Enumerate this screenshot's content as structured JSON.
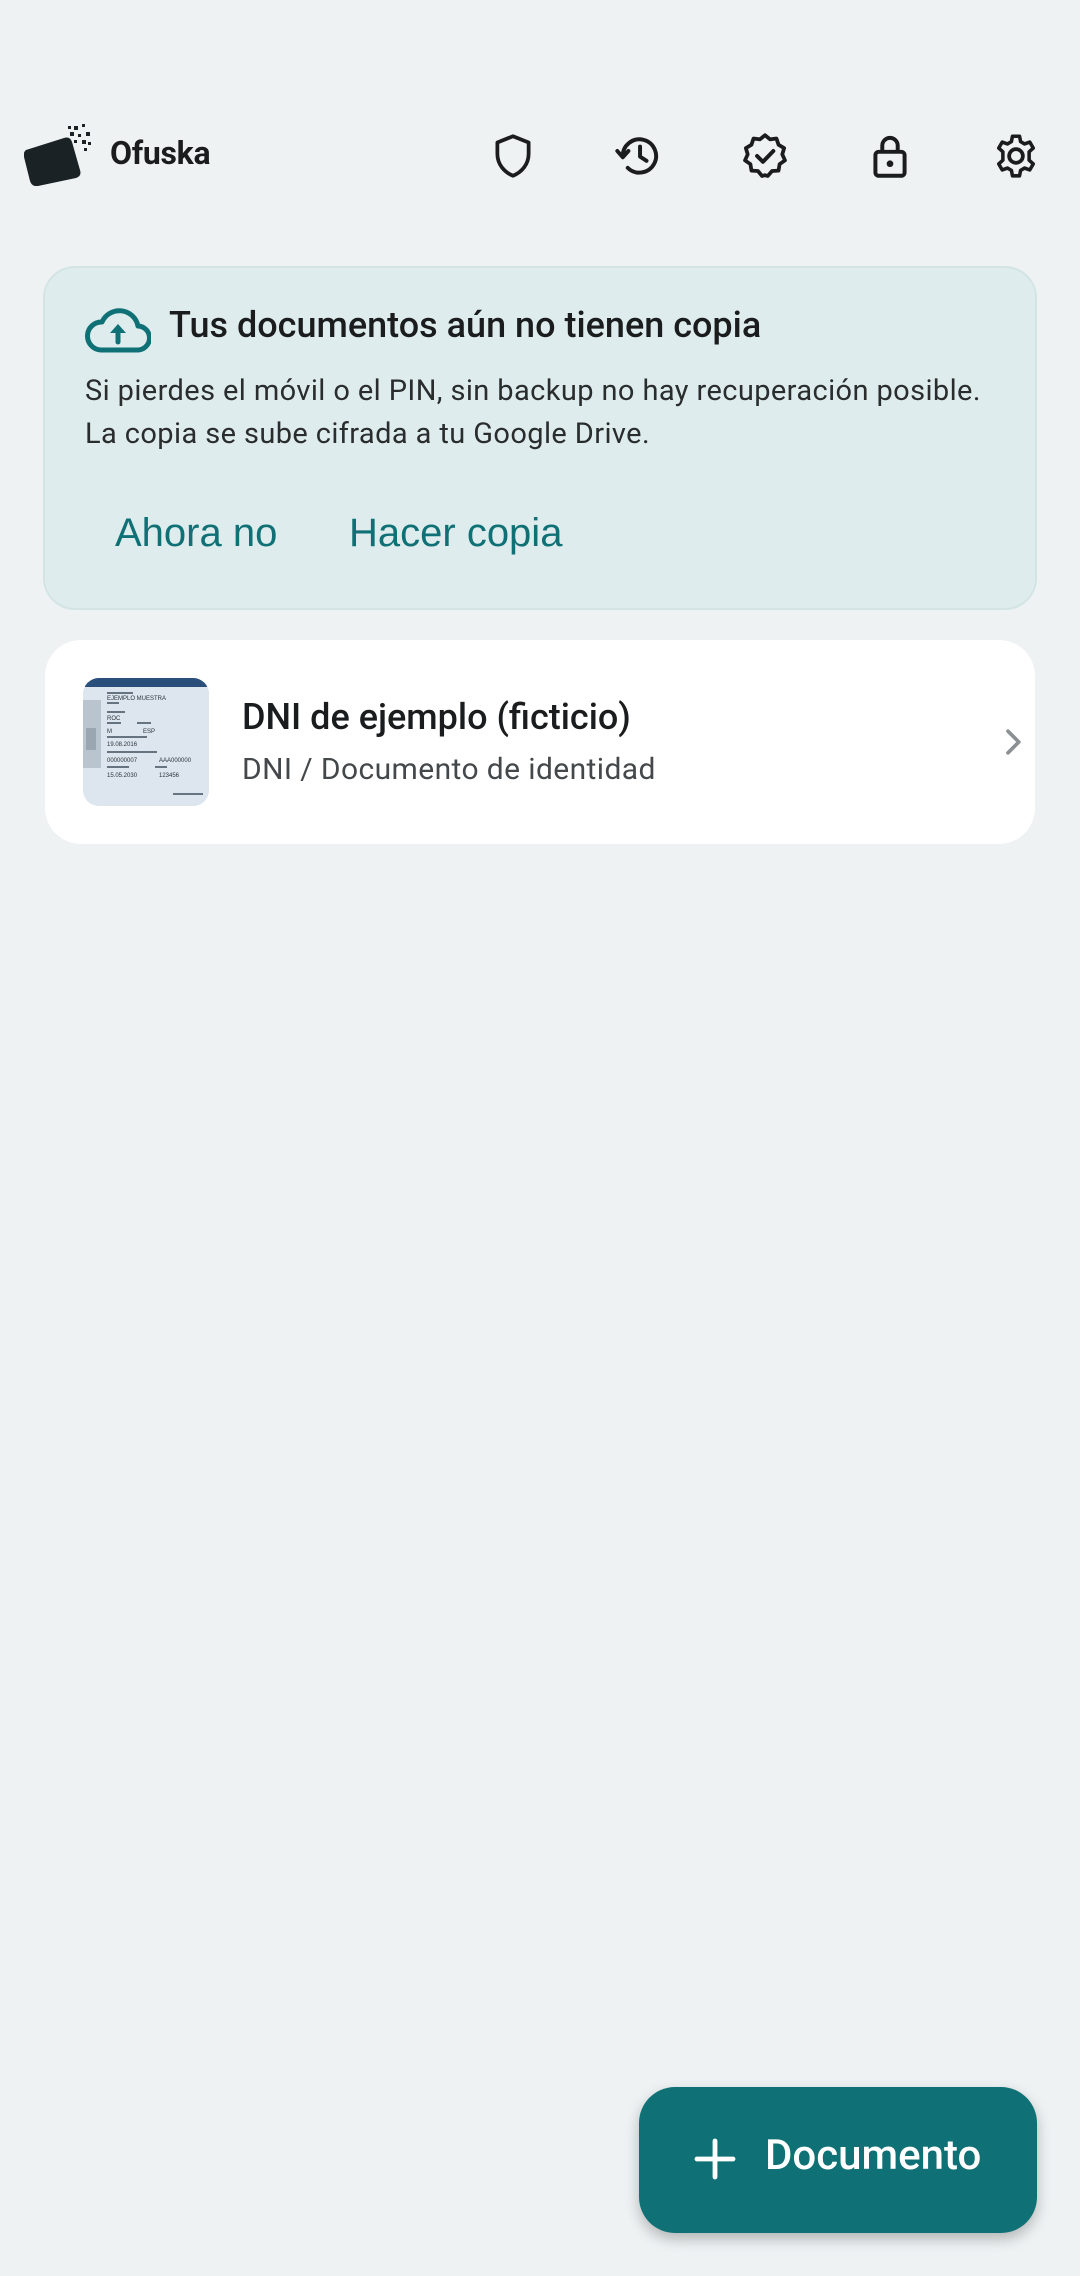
{
  "app": {
    "title": "Ofuska",
    "actions": [
      {
        "name": "shield-icon"
      },
      {
        "name": "history-icon"
      },
      {
        "name": "verified-icon"
      },
      {
        "name": "lock-icon"
      },
      {
        "name": "settings-icon"
      }
    ]
  },
  "backup_banner": {
    "icon": "cloud-upload-icon",
    "title": "Tus documentos aún no tienen copia",
    "body": "Si pierdes el móvil o el PIN, sin backup no hay recuperación posible. La copia se sube cifrada a tu Google Drive.",
    "dismiss_label": "Ahora no",
    "backup_label": "Hacer copia"
  },
  "documents": [
    {
      "title": "DNI de ejemplo (ficticio)",
      "subtitle": "DNI / Documento de identidad",
      "thumbnail": {
        "name": "EJEMPLO MUESTRA",
        "surname_line": "ROC",
        "sex": "M",
        "nationality": "ESP",
        "birth": "19.08.2016",
        "id_number": "000000007",
        "support": "AAA000000",
        "expiry": "15.05.2030",
        "can": "123456"
      }
    }
  ],
  "fab": {
    "label": "Documento",
    "icon": "plus-icon"
  },
  "colors": {
    "background": "#eef2f3",
    "accent": "#0f7175",
    "banner_bg": "#dfeced",
    "card_bg": "#ffffff"
  }
}
